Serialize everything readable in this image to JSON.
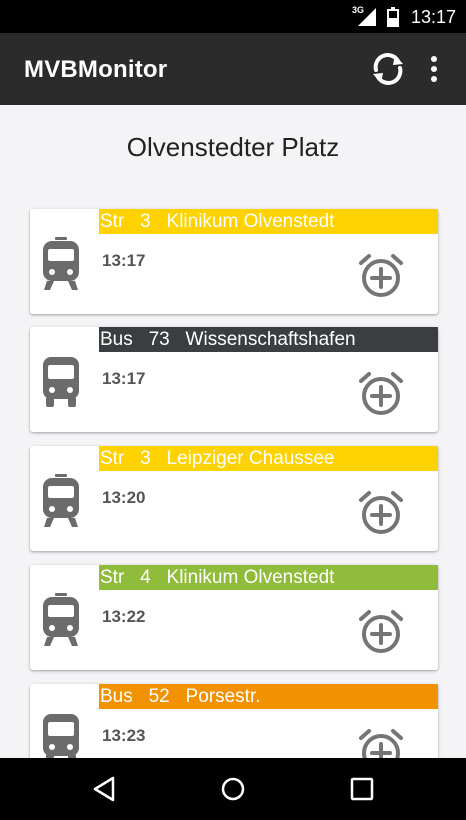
{
  "status_bar": {
    "network": "3G",
    "time": "13:17"
  },
  "app_bar": {
    "title": "MVBMonitor",
    "refresh_icon": "refresh-icon",
    "menu_icon": "more-vert-icon"
  },
  "stop": {
    "name": "Olvenstedter Platz"
  },
  "departures": [
    {
      "type": "Str",
      "line": "3",
      "destination": "Klinikum Olvenstedt",
      "header": "Str   3   Klinikum Olvenstedt",
      "time": "13:17",
      "color": "#ffd200",
      "icon": "tram-icon"
    },
    {
      "type": "Bus",
      "line": "73",
      "destination": "Wissenschaftshafen",
      "header": "Bus   73   Wissenschaftshafen",
      "time": "13:17",
      "color": "#3a3e40",
      "icon": "bus-icon"
    },
    {
      "type": "Str",
      "line": "3",
      "destination": "Leipziger Chaussee",
      "header": "Str   3   Leipziger Chaussee",
      "time": "13:20",
      "color": "#ffd200",
      "icon": "tram-icon"
    },
    {
      "type": "Str",
      "line": "4",
      "destination": "Klinikum Olvenstedt",
      "header": "Str   4   Klinikum Olvenstedt",
      "time": "13:22",
      "color": "#8fbc3a",
      "icon": "tram-icon"
    },
    {
      "type": "Bus",
      "line": "52",
      "destination": "Porsestr.",
      "header": "Bus   52   Porsestr.",
      "time": "13:23",
      "color": "#f39200",
      "icon": "bus-icon"
    }
  ],
  "nav_bar": {
    "back_icon": "back-icon",
    "home_icon": "home-icon",
    "recents_icon": "recents-icon"
  }
}
